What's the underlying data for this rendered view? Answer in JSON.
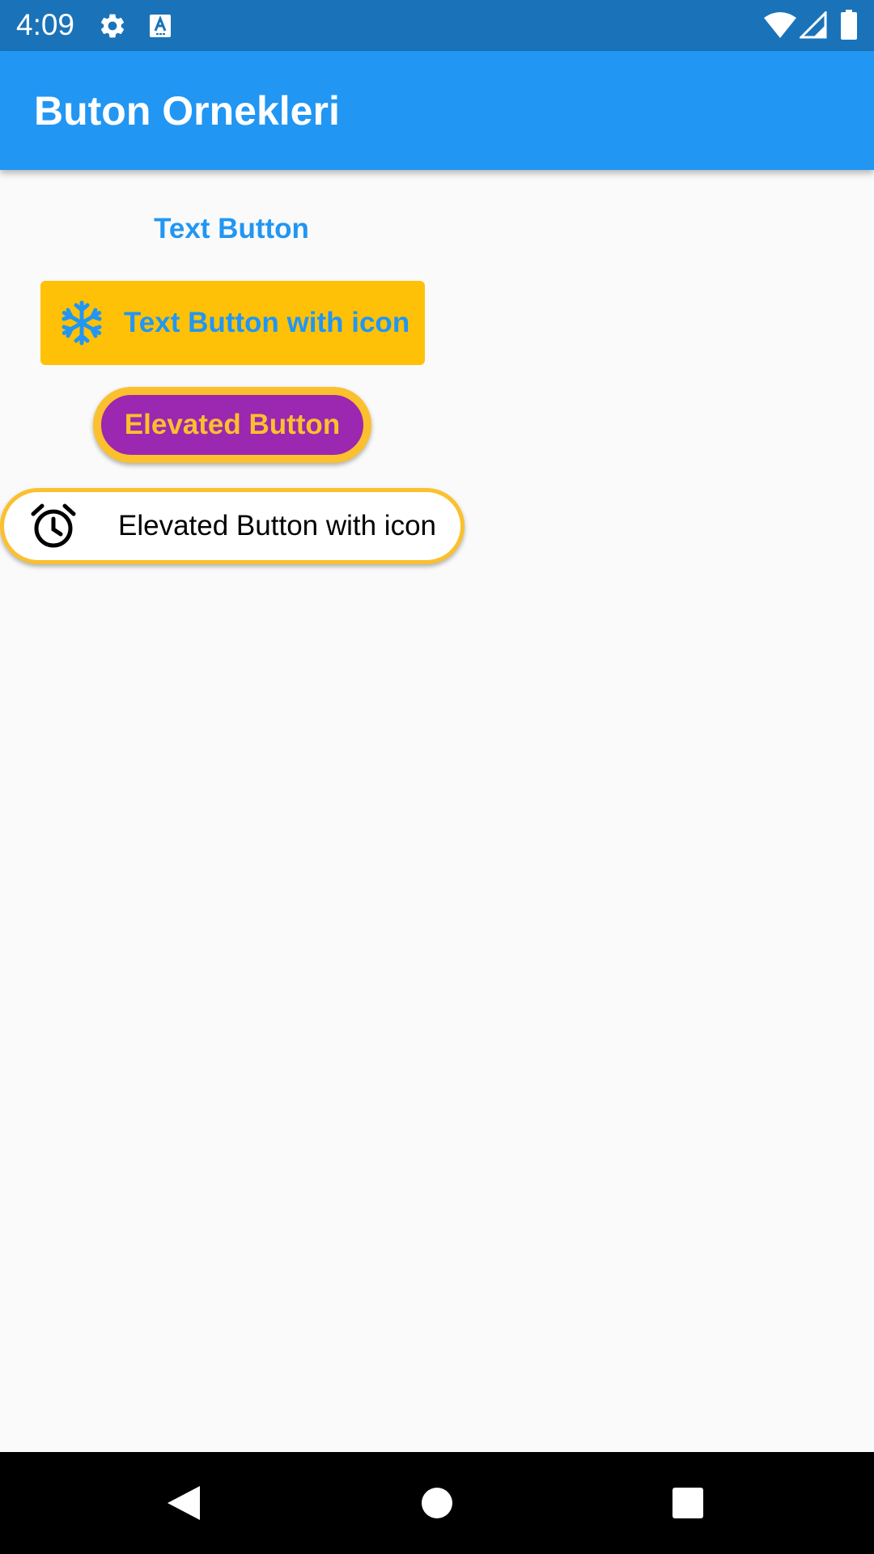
{
  "status_bar": {
    "time": "4:09",
    "icons": [
      "gear-icon",
      "font-a-icon",
      "wifi-icon",
      "signal-icon",
      "battery-icon"
    ],
    "background": "#1A73B9"
  },
  "app_bar": {
    "title": "Buton Ornekleri",
    "background": "#2196F3"
  },
  "buttons": {
    "text_button": {
      "label": "Text Button",
      "color": "#2196F3"
    },
    "text_icon_button": {
      "label": "Text Button with icon",
      "icon": "snowflake-icon",
      "background": "#FFC107",
      "color": "#2196F3"
    },
    "elevated_button": {
      "label": "Elevated Button",
      "background": "#9C27B0",
      "color": "#FBC02D",
      "border": "#FBC02D"
    },
    "elevated_icon_button": {
      "label": "Elevated Button with icon",
      "icon": "alarm-clock-icon",
      "background": "#FFFFFF",
      "color": "#000000",
      "border": "#FBC02D"
    }
  },
  "nav_bar": {
    "items": [
      "back-icon",
      "home-icon",
      "recents-icon"
    ]
  }
}
